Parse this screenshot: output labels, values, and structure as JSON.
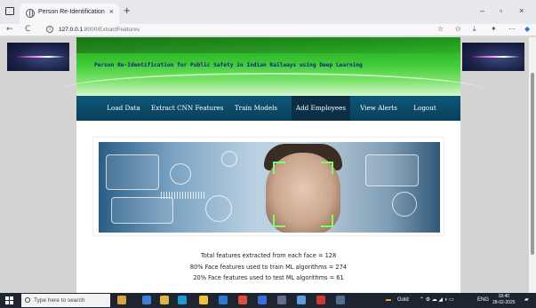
{
  "browser": {
    "tab_title": "Person Re-Identification",
    "tab_close": "×",
    "new_tab": "+",
    "window_controls": {
      "minimize": "–",
      "maximize": "▫",
      "close": "×"
    },
    "back": "←",
    "reload": "C",
    "url_host": "127.0.0.1",
    "url_path": ":8000/ExtractFeatures"
  },
  "page": {
    "heading": "Person Re-Identification for Public Safety in Indian Railways using Deep Learning",
    "menu": [
      {
        "label": "Load Data",
        "active": false
      },
      {
        "label": "Extract CNN Features",
        "active": false
      },
      {
        "label": "Train Models",
        "active": false
      },
      {
        "label": "Add Employees",
        "active": true
      },
      {
        "label": "View Alerts",
        "active": false
      },
      {
        "label": "Logout",
        "active": false
      }
    ],
    "stats": [
      "Total features extracted from each face = 128",
      "80% Face features used to train ML algorithms = 274",
      "20% Face features used to test ML algorithms = 61"
    ]
  },
  "taskbar": {
    "search_placeholder": "Type here to search",
    "weather": "Gold",
    "language": "ENG",
    "time": "18:40",
    "date": "28-02-2025"
  },
  "colors": {
    "menu_bg": "#0d5778",
    "menu_active": "#0b2f45",
    "heading": "#1a1a8c",
    "banner_green": "#3dcb36"
  }
}
